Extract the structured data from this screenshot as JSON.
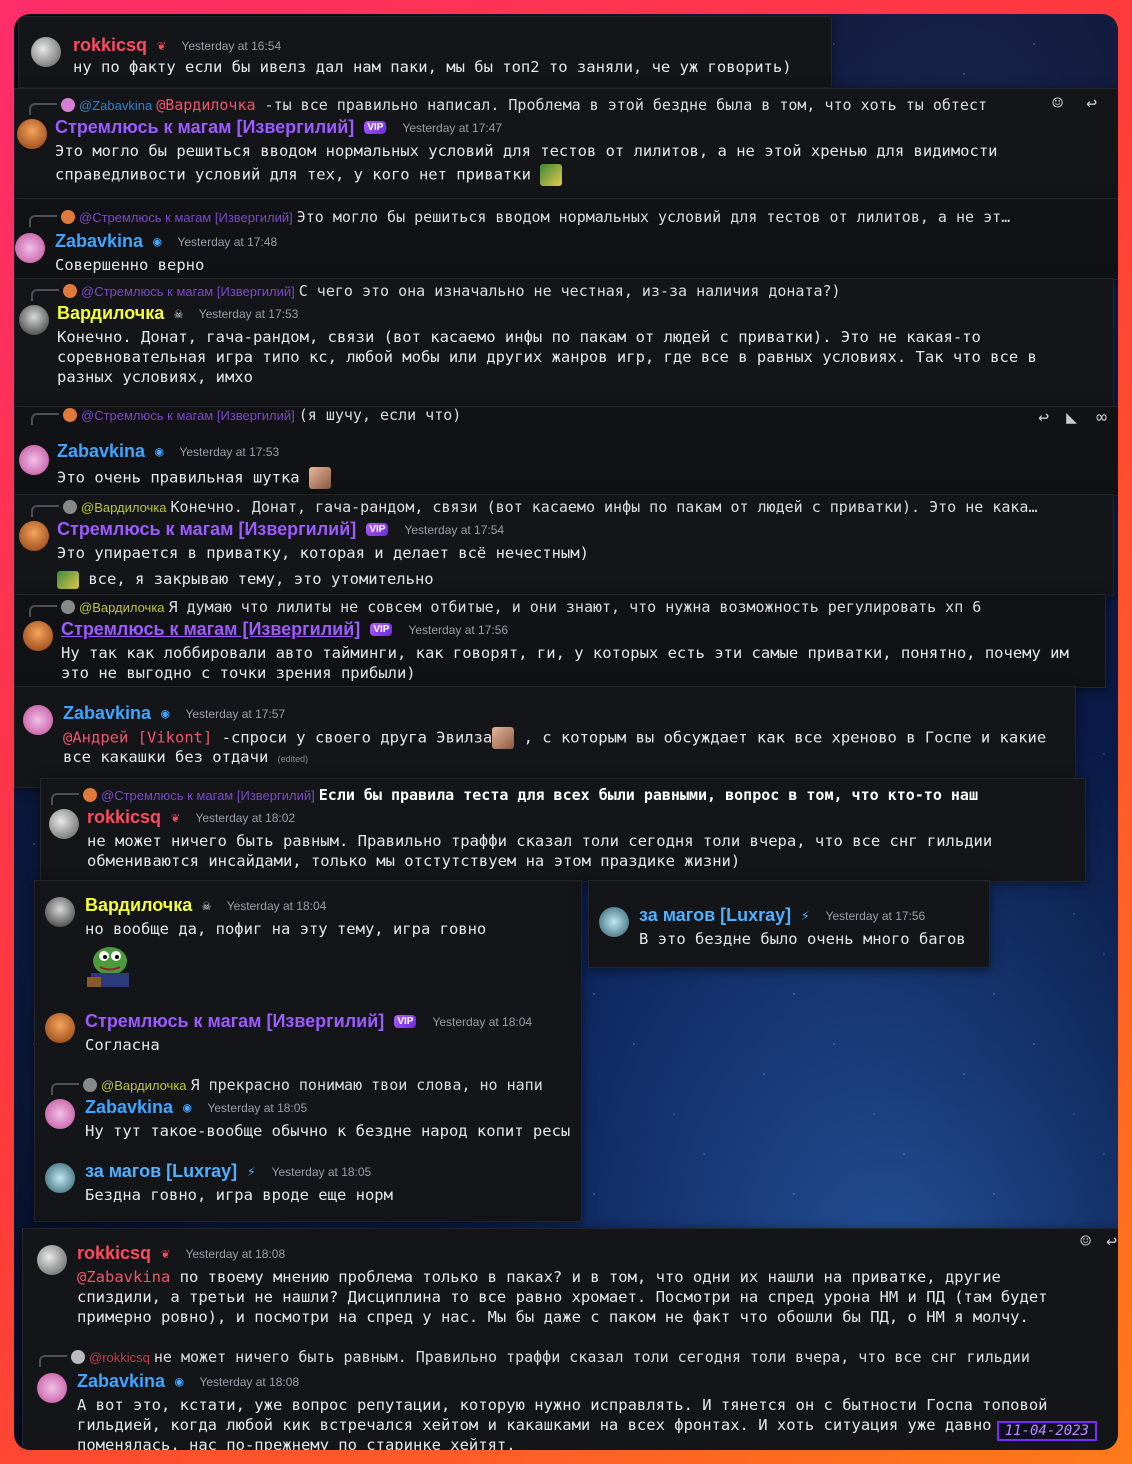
{
  "colors": {
    "rokkicsq": "#ff4a5e",
    "stremlyus": "#9c5bff",
    "zabavkina": "#3fa5ff",
    "vardilochka": "#f4ff3a",
    "luxray": "#4fb0ff",
    "mention": "#f0556b",
    "panel_bg": "#141519"
  },
  "panels": {
    "p1": {
      "author": "rokkicsq",
      "badge": "demon-icon",
      "time": "Yesterday at 16:54",
      "text": "ну по факту если бы ивелз дал нам паки, мы бы топ2 то заняли, че уж говорить)"
    },
    "p2": {
      "reply_name": "@Zabavkina",
      "reply_mention": "@Вардилочка",
      "reply_text": " -ты все правильно написал. Проблема в этой бездне была в том, что хоть ты обтест",
      "author": "Стремлюсь к магам [Извергилий]",
      "time": "Yesterday at 17:47",
      "text1": "Это могло бы решиться вводом нормальных условий для тестов от лилитов, а не этой хренью для видимости",
      "text2": "справедливости условий для тех, у кого нет приватки"
    },
    "p3": {
      "reply_name": "@Стремлюсь к магам [Извергилий]",
      "reply_text": "Это могло бы решиться вводом нормальных условий для тестов от лилитов, а не эт…",
      "author": "Zabavkina",
      "time": "Yesterday at 17:48",
      "text": "Совершенно верно"
    },
    "p4": {
      "reply_name": "@Стремлюсь к магам [Извергилий]",
      "reply_text": "С чего это она изначально не честная, из-за наличия доната?)",
      "author": "Вардилочка",
      "time": "Yesterday at 17:53",
      "text1": "Конечно. Донат, гача-рандом, связи (вот касаемо инфы по пакам от людей с приватки). Это не какая-то",
      "text2": "соревновательная игра типо кс, любой мобы или других жанров игр, где все в равных условиях. Так что все в",
      "text3": "разных условиях, имхо"
    },
    "p5": {
      "reply_name": "@Стремлюсь к магам [Извергилий]",
      "reply_text": "(я шучу, если что)",
      "author": "Zabavkina",
      "time": "Yesterday at 17:53",
      "text": "Это очень правильная шутка"
    },
    "p6": {
      "reply_name": "@Вардилочка",
      "reply_text": "Конечно. Донат, гача-рандом, связи (вот касаемо инфы по пакам от людей с приватки). Это не кака…",
      "author": "Стремлюсь к магам [Извергилий]",
      "time": "Yesterday at 17:54",
      "text1": "Это упирается в приватку, которая и делает всё нечестным)",
      "text2": "все, я закрываю тему, это утомительно"
    },
    "p7": {
      "reply_name": "@Вардилочка",
      "reply_text": "Я думаю что лилиты не совсем отбитые, и они знают, что нужна возможность регулировать хп 6",
      "author": "Стремлюсь к магам [Извергилий]",
      "time": "Yesterday at 17:56",
      "text1": "Ну так как лоббировали авто тайминги, как говорят, ги, у которых есть эти самые приватки, понятно, почему им",
      "text2": "это не выгодно с точки зрения прибыли)"
    },
    "p8": {
      "author": "Zabavkina",
      "time": "Yesterday at 17:57",
      "mention": "@Андрей [Vikont]",
      "text1": " -спроси у своего друга Эвилза",
      "text1b": " , с которым вы обсуждает как все хреново в Госпе и какие",
      "text2": "все какашки без отдачи",
      "edited": "(edited)"
    },
    "p9": {
      "reply_name": "@Стремлюсь к магам [Извергилий]",
      "reply_text": "Если бы правила теста для всех были равными, вопрос в том, что кто-то наш",
      "author": "rokkicsq",
      "time": "Yesterday at 18:02",
      "text1": "не может ничего быть равным. Правильно траффи сказал толи сегодня толи вчера, что все снг гильдии",
      "text2": "обмениваются инсайдами, только мы отстутствуем на этом праздике жизни)"
    },
    "p10": {
      "author": "Вардилочка",
      "time": "Yesterday at 18:04",
      "text": "но вообще да, пофиг на эту тему, игра говно",
      "m2_author": "Стремлюсь к магам [Извергилий]",
      "m2_time": "Yesterday at 18:04",
      "m2_text": "Согласна",
      "m3_reply_name": "@Вардилочка",
      "m3_reply_text": "Я прекрасно понимаю твои слова, но напи",
      "m3_author": "Zabavkina",
      "m3_time": "Yesterday at 18:05",
      "m3_text": "Ну тут такое-вообще обычно к бездне народ копит ресы",
      "m4_author": "за магов [Luxray]",
      "m4_time": "Yesterday at 18:05",
      "m4_text": "Бездна говно, игра вроде еще норм"
    },
    "p11": {
      "author": "за магов [Luxray]",
      "time": "Yesterday at 17:56",
      "text": "В это бездне было очень много багов"
    },
    "p12": {
      "author": "rokkicsq",
      "time": "Yesterday at 18:08",
      "mention": "@Zabavkina",
      "text1": " по твоему мнению проблема только в паках? и в том, что одни их нашли на приватке, другие",
      "text2": "спиздили, а третьи не нашли? Дисциплина то все равно хромает. Посмотри на спред урона НМ и ПД (там будет",
      "text3": "примерно ровно), и посмотри на спред у нас. Мы бы даже с паком не факт что обошли бы ПД, о НМ я молчу.",
      "m2_reply_name": "@rokkicsq",
      "m2_reply_text": "не может ничего быть равным. Правильно траффи сказал толи сегодня толи вчера, что все снг гильдии",
      "m2_author": "Zabavkina",
      "m2_time": "Yesterday at 18:08",
      "m2_text1": "А вот это, кстати, уже вопрос репутации, которую нужно исправлять. И тянется он с бытности Госпа топовой",
      "m2_text2": "гильдией, когда любой кик встречался хейтом и какашками на всех фронтах. И хоть ситуация уже давно",
      "m2_text3": "поменялась, нас по-прежнему по старинке хейтят."
    }
  },
  "date_stamp": "11-04-2023"
}
